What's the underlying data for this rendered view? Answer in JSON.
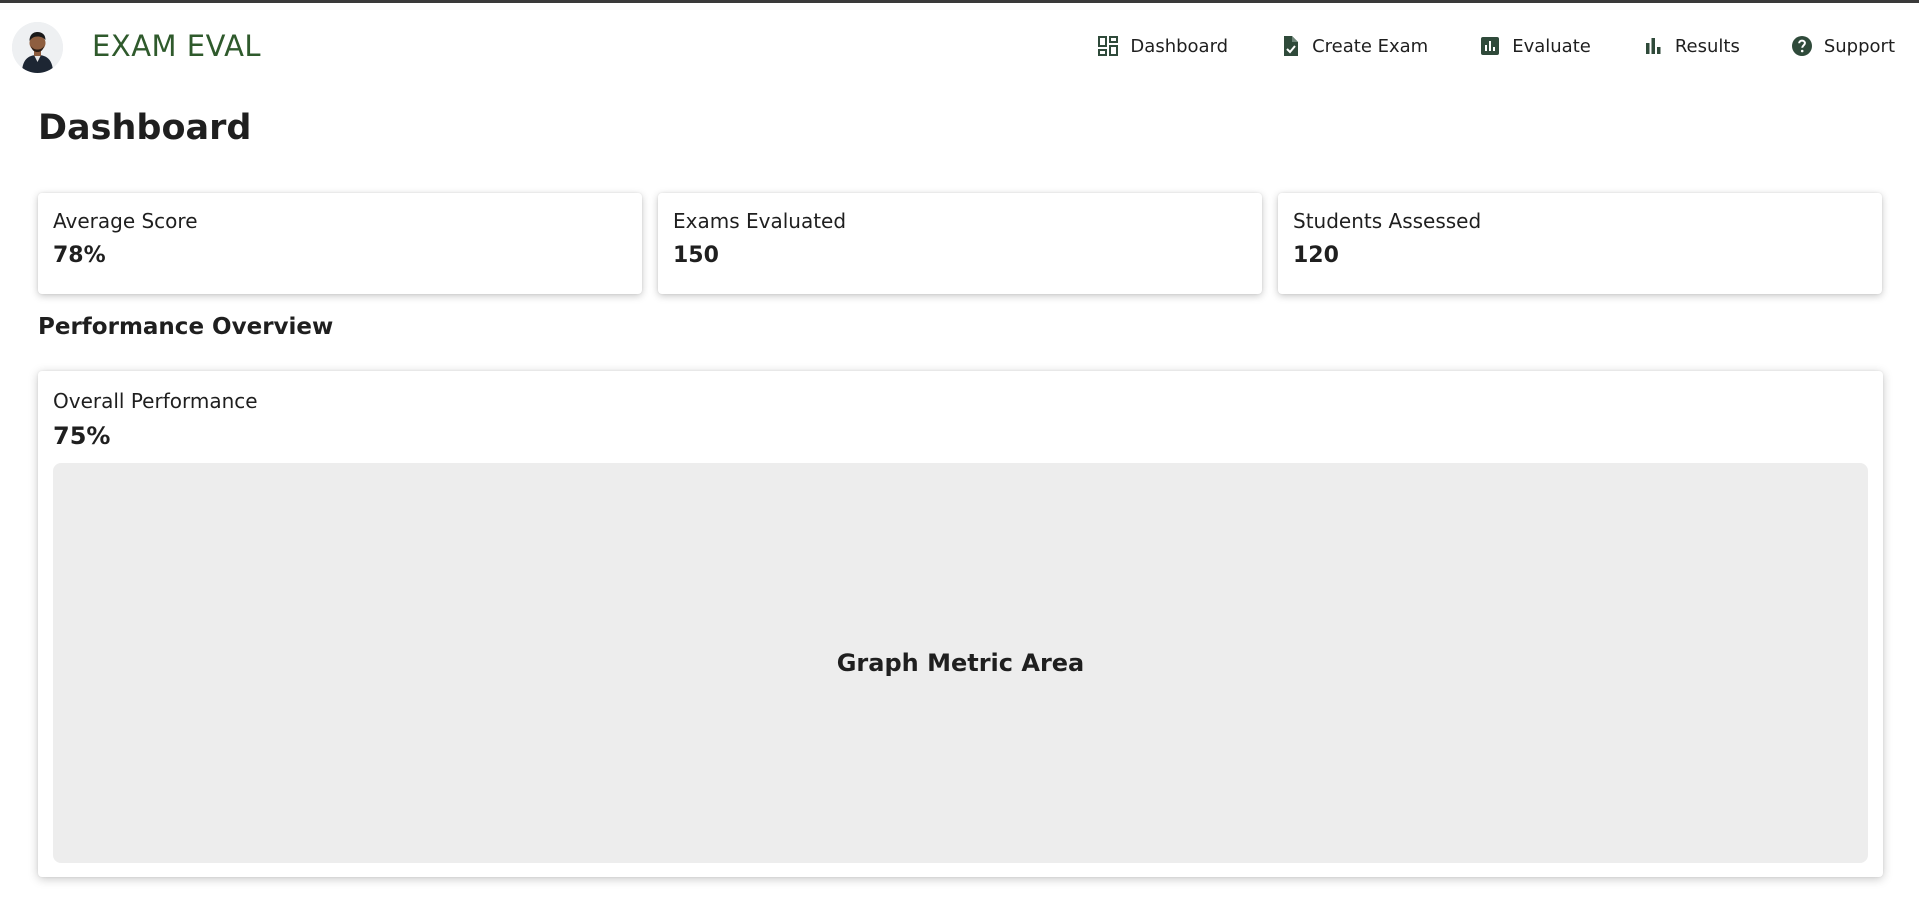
{
  "app": {
    "brand": "EXAM EVAL"
  },
  "nav": {
    "items": [
      {
        "label": "Dashboard",
        "icon": "dashboard-icon"
      },
      {
        "label": "Create Exam",
        "icon": "document-check-icon"
      },
      {
        "label": "Evaluate",
        "icon": "bar-chart-box-icon"
      },
      {
        "label": "Results",
        "icon": "bar-chart-icon"
      },
      {
        "label": "Support",
        "icon": "help-circle-icon"
      }
    ]
  },
  "page": {
    "title": "Dashboard"
  },
  "stats": [
    {
      "label": "Average Score",
      "value": "78%"
    },
    {
      "label": "Exams Evaluated",
      "value": "150"
    },
    {
      "label": "Students Assessed",
      "value": "120"
    }
  ],
  "performance": {
    "section_title": "Performance Overview",
    "label": "Overall Performance",
    "value": "75%",
    "graph_placeholder": "Graph Metric Area"
  },
  "colors": {
    "brand": "#2f5a2c",
    "icon": "#2f4a3a",
    "graph_bg": "#ededed"
  }
}
